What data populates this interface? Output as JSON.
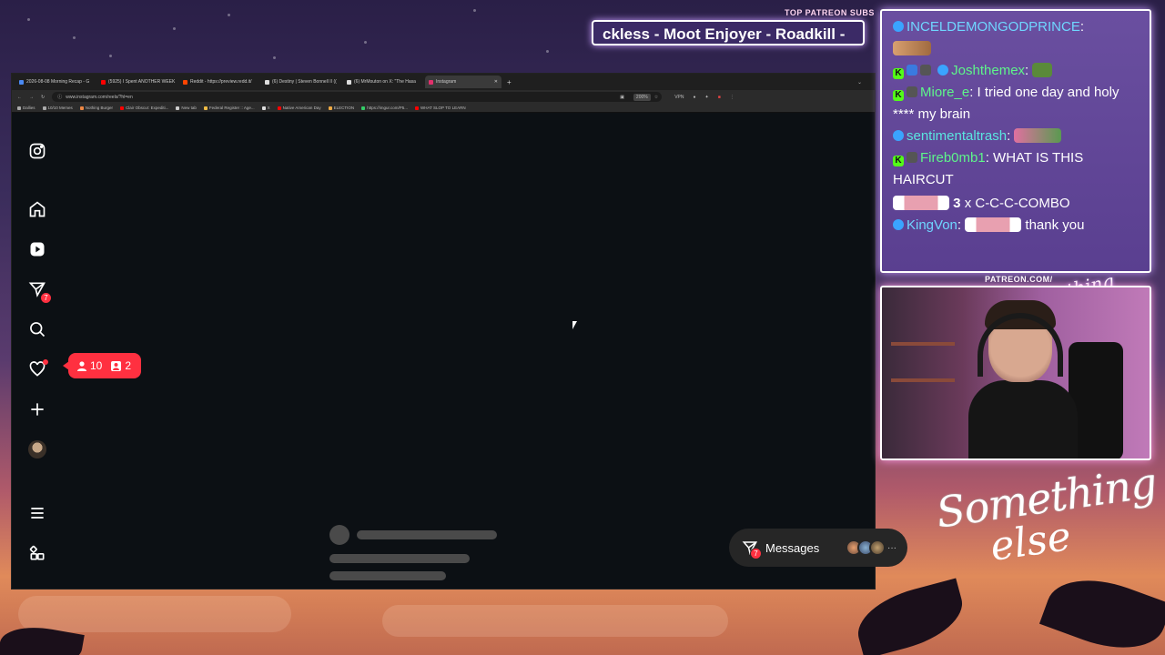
{
  "overlay": {
    "subs_label": "TOP PATREON SUBS",
    "subs_ticker": "ckless - Moot Enjoyer - Roadkill -",
    "patreon_label": "PATREON.COM/",
    "patreon_script": "Anything Else?",
    "logo_line1": "Something",
    "logo_line2": "else"
  },
  "browser": {
    "tabs": [
      {
        "label": "2026-08-08 Morning Recap - G"
      },
      {
        "label": "(5925) I Spent ANOTHER WEEK"
      },
      {
        "label": "Reddit - https://preview.redd.it/"
      },
      {
        "label": "(6) Destiny | Steven Bonnell II (("
      },
      {
        "label": "(6) MrMouton on X: \"The Hasa"
      },
      {
        "label": "Instagram"
      }
    ],
    "url": "www.instagram.com/reels/?hl=en",
    "zoom": "200%",
    "vpn": "VPN",
    "bookmarks": [
      "Dallies",
      "10/10 Memes",
      "Nothing Burger",
      "Clair Obscur: Expediti...",
      "New tab",
      "Federal Register :: Age...",
      "X",
      "Native American Day",
      "ELECTION",
      "https://imgur.com/P5...",
      "WHAT SLOP TO LEARN"
    ]
  },
  "instagram": {
    "messages_badge": "7",
    "notif_followers": "10",
    "notif_requests": "2",
    "messages_label": "Messages",
    "messages_pill_badge": "7",
    "more": "···",
    "colors": {
      "badge_red": "#ff3040",
      "bg": "#0c1014",
      "pill": "#262626"
    }
  },
  "chat": {
    "messages": [
      {
        "user": "INCELDEMONGODPRINCE",
        "text": ""
      },
      {
        "user": "Joshthemex",
        "text": ""
      },
      {
        "user": "Miore_e",
        "text": "I tried one day and holy **** my brain"
      },
      {
        "user": "sentimentaltrash",
        "text": ""
      },
      {
        "user": "Fireb0mb1",
        "text": "WHAT IS THIS HAIRCUT"
      },
      {
        "user": "",
        "text": "C-C-C-COMBO",
        "count": "3",
        "x": "x"
      },
      {
        "user": "KingVon",
        "text": "thank you"
      }
    ]
  }
}
